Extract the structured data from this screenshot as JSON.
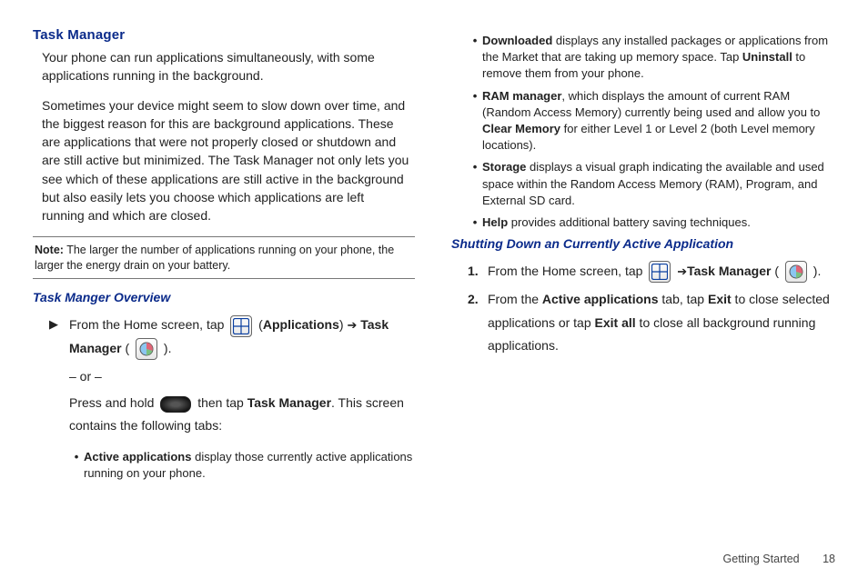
{
  "left": {
    "h1": "Task Manager",
    "p1": "Your phone can run applications simultaneously, with some applications running in the background.",
    "p2": "Sometimes your device might seem to slow down over time, and the biggest reason for this are background applications. These are applications that were not properly closed or shutdown and are still active but minimized. The Task Manager not only lets you see which of these applications are still active in the background but also easily lets you choose which applications are left running and which are closed.",
    "note_label": "Note:",
    "note_body": " The larger the number of applications running on your phone, the larger the energy drain on your battery.",
    "h2": "Task Manger Overview",
    "step_lead": "From the Home screen, tap ",
    "step_apps_label": "Applications",
    "step_tm_label": "Task Manager",
    "or_text": "– or –",
    "press_hold": "Press and hold ",
    "then_tap": " then tap ",
    "then_rest": ". This screen contains the following tabs:",
    "b_active_a": "Active applications",
    "b_active_b": " display those currently active applications running on your phone."
  },
  "right": {
    "b_dl_a": "Downloaded",
    "b_dl_b": " displays any installed packages or applications from the Market that are taking up memory space. Tap ",
    "b_dl_c": "Uninstall",
    "b_dl_d": " to remove them from your phone.",
    "b_ram_a": "RAM manager",
    "b_ram_b": ", which displays the amount of current RAM (Random Access Memory) currently being used and allow you to ",
    "b_ram_c": "Clear Memory",
    "b_ram_d": " for either Level 1 or Level 2 (both Level memory locations).",
    "b_store_a": "Storage",
    "b_store_b": " displays a visual graph indicating the available and used space within the Random Access Memory (RAM), Program, and External SD card.",
    "b_help_a": "Help",
    "b_help_b": " provides additional battery saving techniques.",
    "h2": "Shutting Down an Currently Active Application",
    "s1_a": "From the Home screen, tap ",
    "s1_b": "Task Manager",
    "s2_a": "From the ",
    "s2_b": "Active applications",
    "s2_c": " tab, tap ",
    "s2_d": "Exit",
    "s2_e": " to close selected applications or tap ",
    "s2_f": "Exit all",
    "s2_g": " to close all background running applications."
  },
  "footer": {
    "section": "Getting Started",
    "page": "18"
  },
  "steps": {
    "one": "1.",
    "two": "2."
  }
}
